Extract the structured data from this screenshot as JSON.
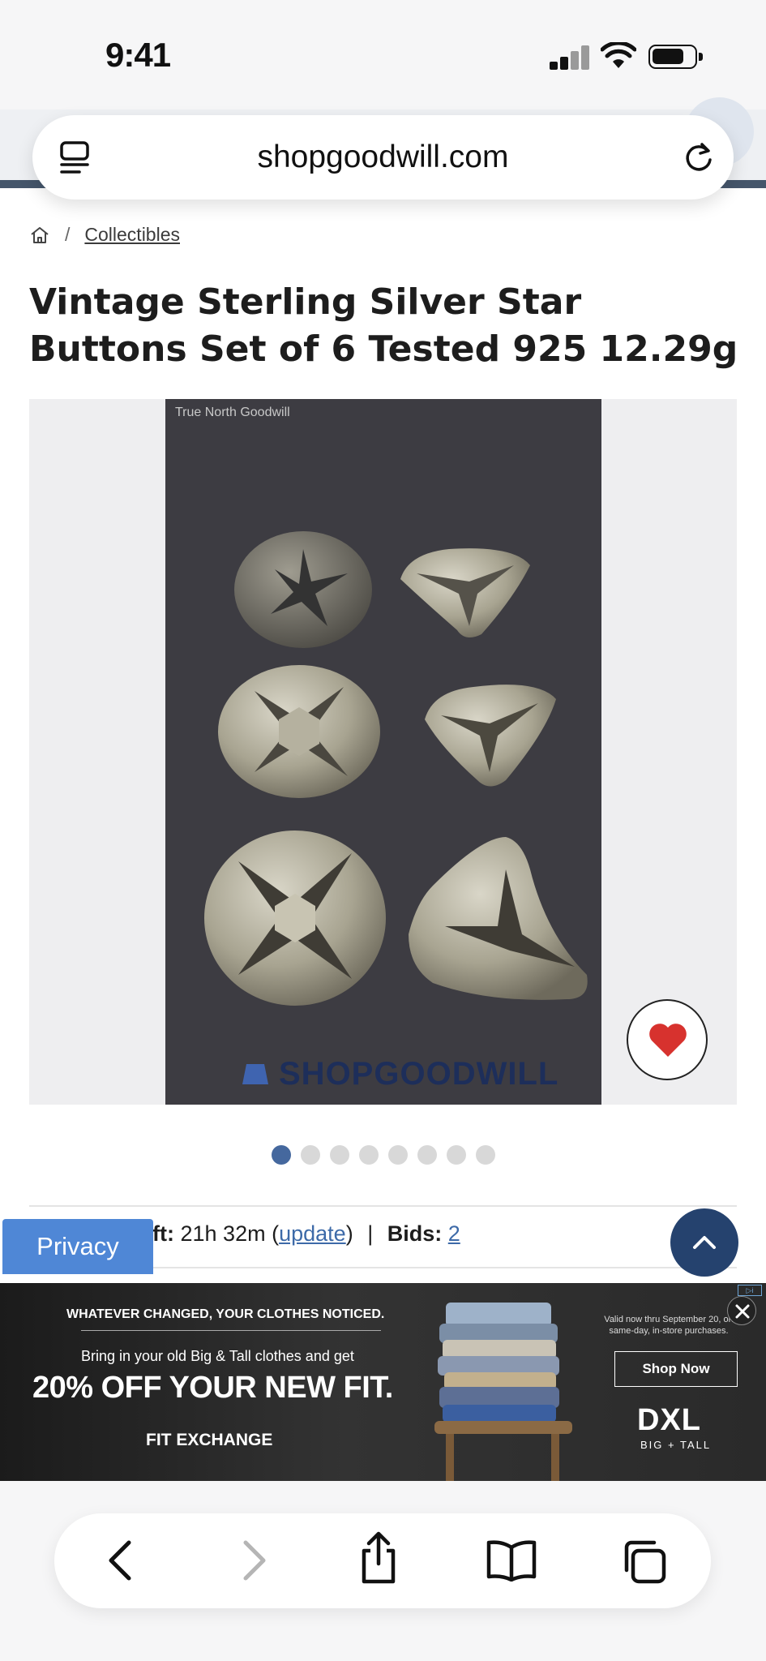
{
  "status_bar": {
    "time": "9:41"
  },
  "browser": {
    "url": "shopgoodwill.com"
  },
  "breadcrumb": {
    "category": "Collectibles"
  },
  "item": {
    "title": "Vintage Sterling Silver Star Buttons Set of 6 Tested 925 12.29g",
    "photo_caption": "True North Goodwill",
    "watermark": "SHOPGOODWILL",
    "image_count": 8,
    "active_image": 1
  },
  "auction": {
    "time_left_label": "ft:",
    "time_left_value": "21h 32m",
    "update_open": "(",
    "update_link": "update",
    "update_close": ")",
    "separator": "|",
    "bids_label": "Bids:",
    "bids_value": "2"
  },
  "privacy_label": "Privacy",
  "ad": {
    "line1": "WHATEVER CHANGED, YOUR CLOTHES NOTICED.",
    "line2": "Bring in your old Big & Tall clothes and get",
    "headline": "20% OFF YOUR NEW FIT.",
    "program": "FIT EXCHANGE",
    "valid_text": "Valid now thru September 20, on same-day, in-store purchases.",
    "cta": "Shop Now",
    "brand": "DXL",
    "brand_sub": "BIG + TALL"
  },
  "colors": {
    "accent": "#45689e",
    "heart": "#d7322e",
    "scroll_button": "#25426e",
    "privacy": "#4f87d6"
  }
}
